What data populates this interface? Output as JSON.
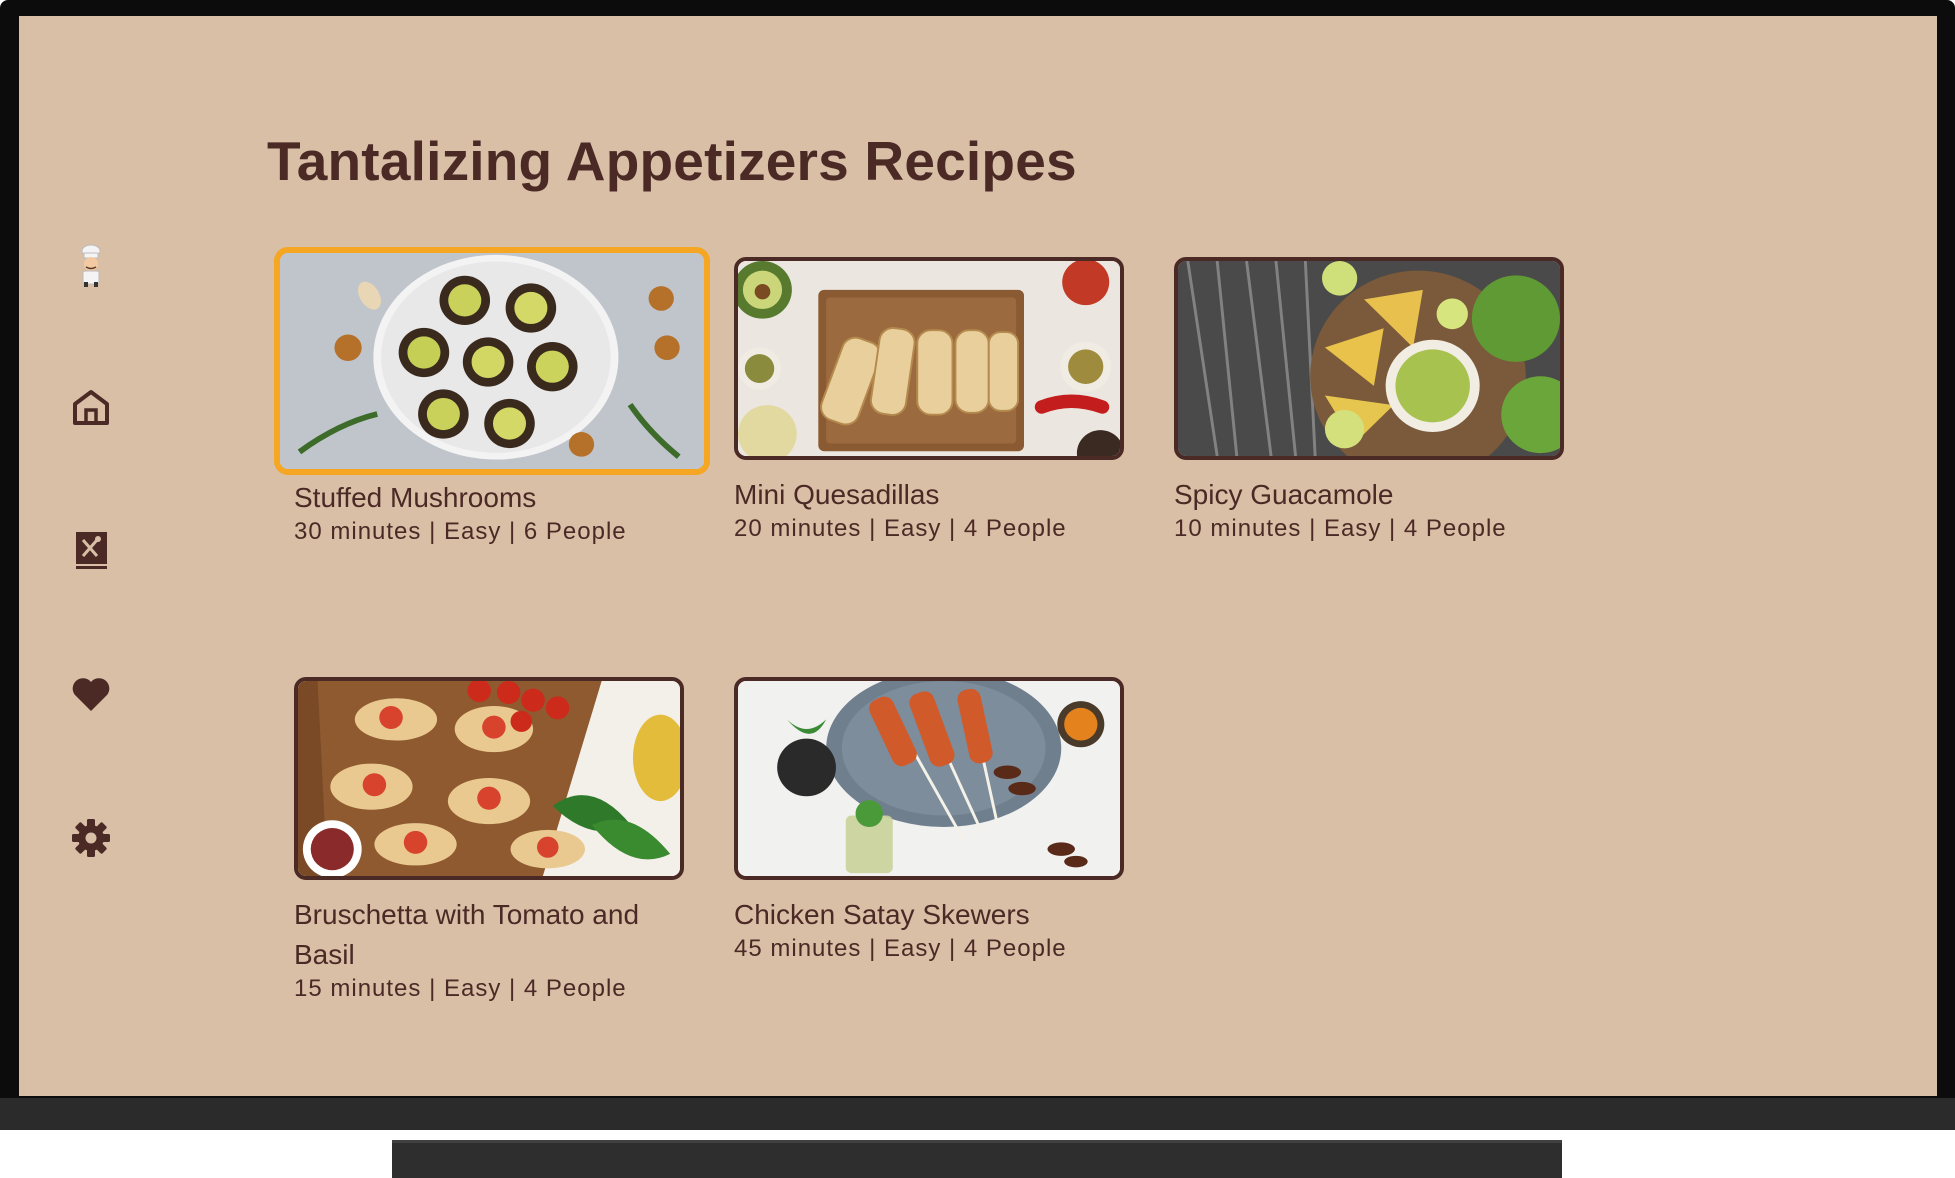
{
  "page": {
    "title": "Tantalizing Appetizers Recipes"
  },
  "nav": [
    {
      "id": "profile",
      "icon": "chef-avatar-icon"
    },
    {
      "id": "home",
      "icon": "home-icon"
    },
    {
      "id": "recipes",
      "icon": "recipe-book-icon"
    },
    {
      "id": "favorites",
      "icon": "heart-icon"
    },
    {
      "id": "settings",
      "icon": "gear-icon"
    }
  ],
  "recipes": [
    {
      "title": "Stuffed Mushrooms",
      "meta": "30 minutes | Easy | 6 People",
      "focused": true
    },
    {
      "title": "Mini Quesadillas",
      "meta": "20 minutes | Easy | 4 People"
    },
    {
      "title": "Spicy Guacamole",
      "meta": "10 minutes | Easy | 4 People"
    },
    {
      "title": "Bruschetta with Tomato and Basil",
      "meta": "15 minutes | Easy | 4 People"
    },
    {
      "title": "Chicken Satay Skewers",
      "meta": "45 minutes | Easy | 4 People"
    }
  ],
  "colors": {
    "background": "#d9bfa6",
    "text": "#4b2a26",
    "focus": "#f5a623"
  }
}
